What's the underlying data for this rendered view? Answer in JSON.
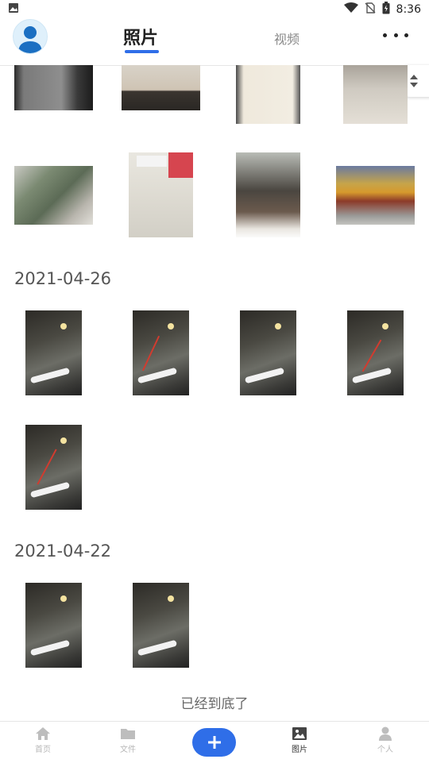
{
  "status_bar": {
    "time": "8:36"
  },
  "header": {
    "tab_photos": "照片",
    "tab_videos": "视频"
  },
  "sections": [
    {
      "date": "2021-04-26",
      "photo_count": 5
    },
    {
      "date": "2021-04-22",
      "photo_count": 2
    }
  ],
  "footer_message": "已经到底了",
  "bottom_nav": {
    "home": "首页",
    "files": "文件",
    "pictures": "图片",
    "profile": "个人"
  },
  "colors": {
    "accent": "#2f6ee8",
    "inactive_nav": "#b8b8b8"
  }
}
